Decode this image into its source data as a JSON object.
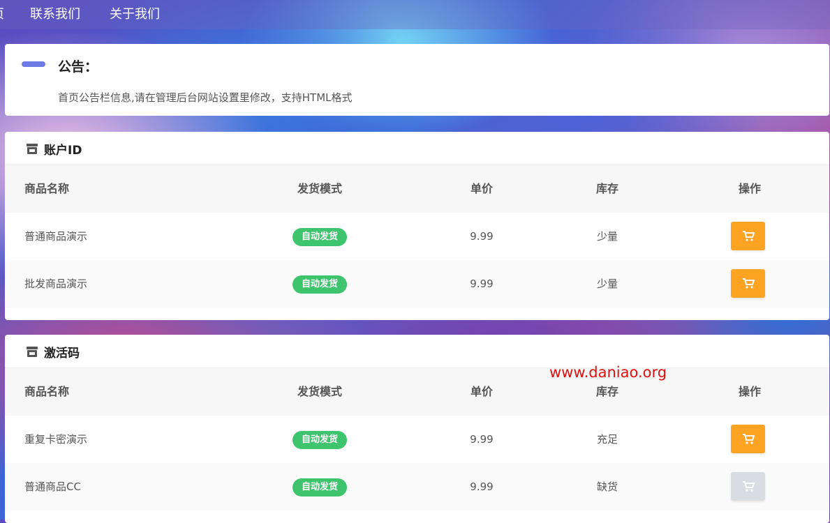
{
  "nav": {
    "items": [
      "页",
      "联系我们",
      "关于我们"
    ]
  },
  "notice": {
    "title": "公告：",
    "text": "首页公告栏信息,请在管理后台网站设置里修改，支持HTML格式"
  },
  "table_headers": {
    "name": "商品名称",
    "mode": "发货模式",
    "price": "单价",
    "stock": "库存",
    "action": "操作"
  },
  "categories": [
    {
      "title": "账户ID",
      "products": [
        {
          "name": "普通商品演示",
          "mode": "自动发货",
          "price": "9.99",
          "stock": "少量",
          "buy_enabled": true
        },
        {
          "name": "批发商品演示",
          "mode": "自动发货",
          "price": "9.99",
          "stock": "少量",
          "buy_enabled": true
        }
      ]
    },
    {
      "title": "激活码",
      "products": [
        {
          "name": "重复卡密演示",
          "mode": "自动发货",
          "price": "9.99",
          "stock": "充足",
          "buy_enabled": true
        },
        {
          "name": "普通商品CC",
          "mode": "自动发货",
          "price": "9.99",
          "stock": "缺货",
          "buy_enabled": false
        }
      ]
    }
  ],
  "watermark": "www.daniao.org",
  "colors": {
    "accent_bar": "#6e7be6",
    "badge_green": "#3ec46d",
    "cart_orange": "#ffa323",
    "cart_disabled": "#d7dde3",
    "watermark_red": "#e01010"
  },
  "icons": {
    "category": "store-icon",
    "buy": "cart-icon"
  }
}
